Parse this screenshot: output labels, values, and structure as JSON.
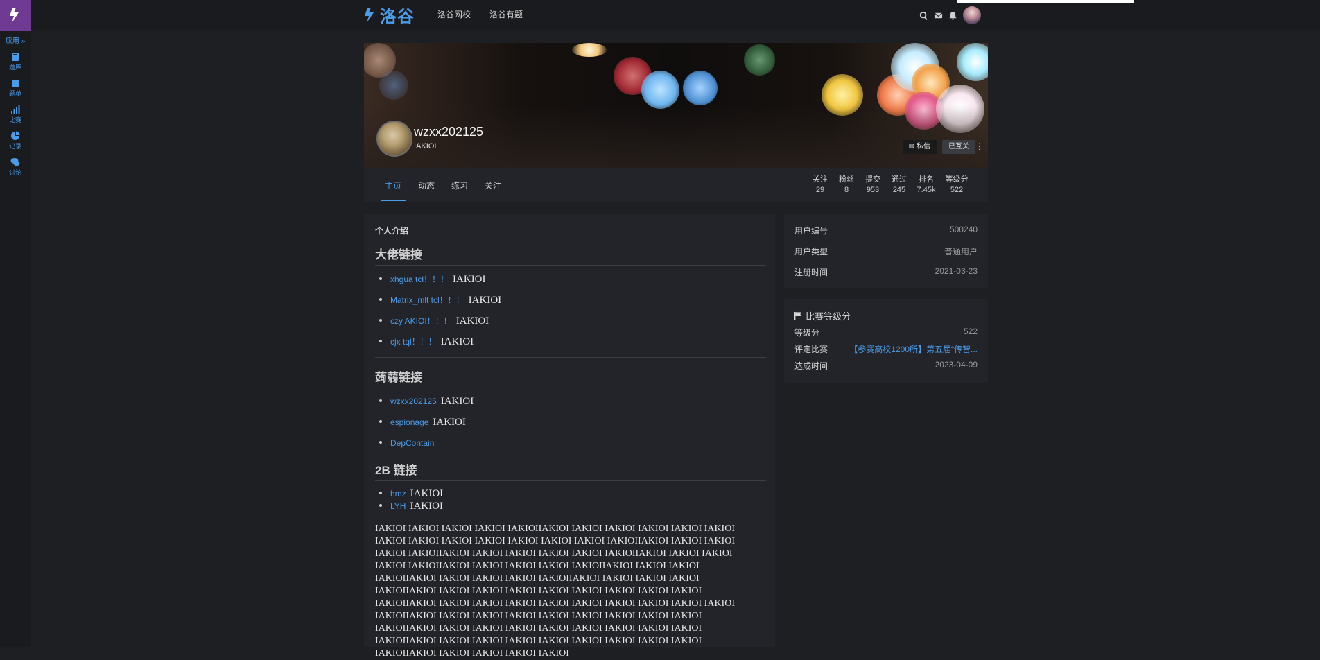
{
  "sidebar": {
    "apps_label": "应用 »",
    "items": [
      {
        "label": "题库",
        "icon": "book-icon"
      },
      {
        "label": "题单",
        "icon": "clipboard-icon"
      },
      {
        "label": "比赛",
        "icon": "bar-chart-icon"
      },
      {
        "label": "记录",
        "icon": "pie-chart-icon"
      },
      {
        "label": "讨论",
        "icon": "comments-icon"
      }
    ]
  },
  "header": {
    "brand": "洛谷",
    "nav": [
      "洛谷网校",
      "洛谷有题"
    ],
    "icons": [
      "search-icon",
      "mail-icon",
      "bell-icon",
      "avatar"
    ]
  },
  "profile": {
    "username": "wzxx202125",
    "slogan": "IAKIOI",
    "message_button": "私信",
    "follow_button": "已互关",
    "more": "⋮"
  },
  "tabs": [
    "主页",
    "动态",
    "练习",
    "关注"
  ],
  "stats": [
    {
      "label": "关注",
      "value": "29"
    },
    {
      "label": "粉丝",
      "value": "8"
    },
    {
      "label": "提交",
      "value": "953"
    },
    {
      "label": "通过",
      "value": "245"
    },
    {
      "label": "排名",
      "value": "7.45k"
    },
    {
      "label": "等级分",
      "value": "522"
    }
  ],
  "intro": {
    "title": "个人介绍",
    "sections": [
      {
        "heading": "大佬链接",
        "items": [
          {
            "link": "xhgua tcl！！！",
            "text": "IAKIOI"
          },
          {
            "link": "Matrix_mlt tcl！！！",
            "text": "IAKIOI"
          },
          {
            "link": "czy AKIOI！！！",
            "text": "IAKIOI"
          },
          {
            "link": "cjx tql！！！",
            "text": "IAKIOI"
          }
        ]
      },
      {
        "heading": "蒟蒻链接",
        "items": [
          {
            "link": "wzxx202125",
            "text": "IAKIOI"
          },
          {
            "link": "espionage",
            "text": "IAKIOI"
          },
          {
            "link": "DepContain",
            "text": ""
          }
        ]
      },
      {
        "heading": "2B 链接",
        "items": [
          {
            "link": "hmz",
            "text": "IAKIOI"
          },
          {
            "link": "LYH",
            "text": "IAKIOI"
          }
        ]
      }
    ],
    "filler_text": "IAKIOI IAKIOI IAKIOI IAKIOI IAKIOIIAKIOI IAKIOI IAKIOI IAKIOI IAKIOI IAKIOI IAKIOI IAKIOI IAKIOI IAKIOI IAKIOI IAKIOI IAKIOI IAKIOIIAKIOI IAKIOI IAKIOI IAKIOI IAKIOIIAKIOI IAKIOI IAKIOI IAKIOI IAKIOI IAKIOIIAKIOI IAKIOI IAKIOI IAKIOI IAKIOIIAKIOI IAKIOI IAKIOI IAKIOI IAKIOIIAKIOI IAKIOI IAKIOI IAKIOIIAKIOI IAKIOI IAKIOI IAKIOI IAKIOIIAKIOI IAKIOI IAKIOI IAKIOI IAKIOIIAKIOI IAKIOI IAKIOI IAKIOI IAKIOI IAKIOI IAKIOI IAKIOI IAKIOI IAKIOIIAKIOI IAKIOI IAKIOI IAKIOI IAKIOI IAKIOI IAKIOI IAKIOI IAKIOI IAKIOI IAKIOIIAKIOI IAKIOI IAKIOI IAKIOI IAKIOI IAKIOI IAKIOI IAKIOI IAKIOI IAKIOIIAKIOI IAKIOI IAKIOI IAKIOI IAKIOI IAKIOI IAKIOI IAKIOI IAKIOI IAKIOIIAKIOI IAKIOI IAKIOI IAKIOI IAKIOI IAKIOI IAKIOI IAKIOI IAKIOI IAKIOIIAKIOI IAKIOI IAKIOI IAKIOI IAKIOI"
  },
  "user_info": [
    {
      "label": "用户编号",
      "value": "500240"
    },
    {
      "label": "用户类型",
      "value": "普通用户"
    },
    {
      "label": "注册时间",
      "value": "2021-03-23"
    }
  ],
  "rating": {
    "title": "比赛等级分",
    "rows": [
      {
        "label": "等级分",
        "value": "522"
      },
      {
        "label": "评定比赛",
        "value": "【参赛高校1200所】第五届“传智..."
      },
      {
        "label": "达成时间",
        "value": "2023-04-09"
      }
    ]
  },
  "colors": {
    "accent": "#4b9be8",
    "sidebar_logo": "#6f3a93",
    "background": "#1e1f22",
    "card": "#22242a"
  }
}
